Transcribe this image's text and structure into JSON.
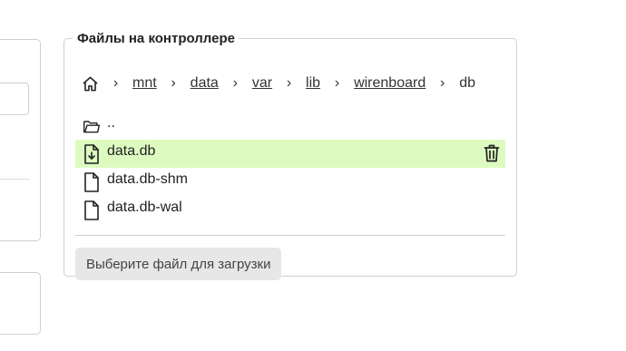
{
  "fieldset": {
    "legend": "Файлы на контроллере"
  },
  "breadcrumb": {
    "home_icon": "home-icon",
    "separator": "›",
    "items": [
      "mnt",
      "data",
      "var",
      "lib",
      "wirenboard"
    ],
    "current": "db"
  },
  "files": [
    {
      "name": "..",
      "icon": "folder-icon",
      "selected": false
    },
    {
      "name": "data.db",
      "icon": "file-download-icon",
      "selected": true,
      "action_icon": "trash-icon"
    },
    {
      "name": "data.db-shm",
      "icon": "file-icon",
      "selected": false
    },
    {
      "name": "data.db-wal",
      "icon": "file-icon",
      "selected": false
    }
  ],
  "upload": {
    "label": "Выберите файл для загрузки"
  },
  "colors": {
    "selected_row": "#ddfbc0",
    "border": "#cfcfcf",
    "button_bg": "#e7e7e7"
  }
}
